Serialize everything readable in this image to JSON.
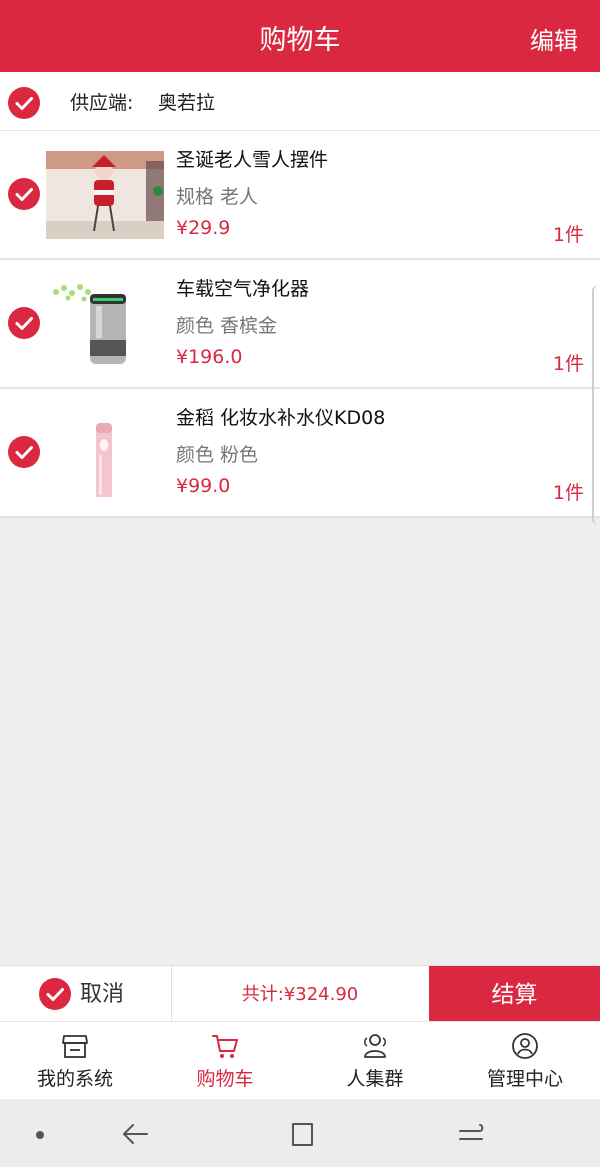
{
  "header": {
    "title": "购物车",
    "edit_label": "编辑"
  },
  "supplier": {
    "label": "供应端:",
    "name": "奥若拉"
  },
  "items": [
    {
      "name": "圣诞老人雪人摆件",
      "spec": "规格 老人",
      "price": "¥29.9",
      "qty": "1件",
      "selected": true
    },
    {
      "name": "车载空气净化器",
      "spec": "颜色 香槟金",
      "price": "¥196.0",
      "qty": "1件",
      "selected": true
    },
    {
      "name": "金稻 化妆水补水仪KD08",
      "spec": "颜色 粉色",
      "price": "¥99.0",
      "qty": "1件",
      "selected": true
    }
  ],
  "checkout": {
    "cancel_label": "取消",
    "total_label": "共计:¥324.90",
    "pay_label": "结算"
  },
  "tabs": [
    {
      "label": "我的系统",
      "icon": "store-icon",
      "active": false
    },
    {
      "label": "购物车",
      "icon": "cart-icon",
      "active": true
    },
    {
      "label": "人集群",
      "icon": "users-icon",
      "active": false
    },
    {
      "label": "管理中心",
      "icon": "profile-icon",
      "active": false
    }
  ],
  "colors": {
    "accent": "#d9283f",
    "background": "#efefef"
  }
}
